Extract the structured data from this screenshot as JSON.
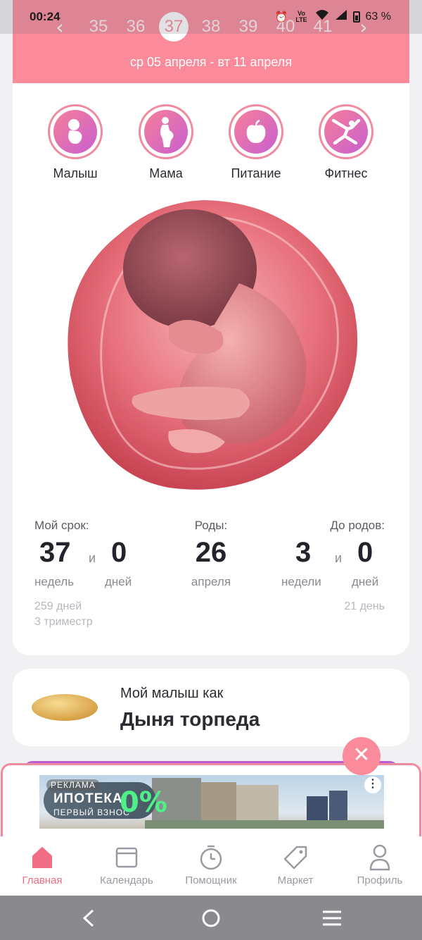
{
  "status_bar": {
    "time": "00:24",
    "network_label": "Vo LTE",
    "battery": "63 %"
  },
  "week_selector": {
    "prev_icon": "chevron-left-icon",
    "next_icon": "chevron-right-icon",
    "weeks": [
      "35",
      "36",
      "37",
      "38",
      "39",
      "40",
      "41"
    ],
    "current_week": "37",
    "date_range": "ср 05 апреля - вт 11 апреля"
  },
  "categories": [
    {
      "label": "Малыш",
      "icon": "baby-icon"
    },
    {
      "label": "Мама",
      "icon": "pregnant-mother-icon"
    },
    {
      "label": "Питание",
      "icon": "apple-icon"
    },
    {
      "label": "Фитнес",
      "icon": "fitness-icon"
    }
  ],
  "stats": {
    "term": {
      "title": "Мой срок:",
      "weeks_value": "37",
      "connector": "и",
      "days_value": "0",
      "weeks_unit": "недель",
      "days_unit": "дней",
      "total_days": "259 дней",
      "trimester": "3 триместр"
    },
    "birth": {
      "title": "Роды:",
      "day": "26",
      "month": "апреля"
    },
    "remaining": {
      "title": "До родов:",
      "weeks_value": "3",
      "connector": "и",
      "days_value": "0",
      "weeks_unit": "недели",
      "days_unit": "дней",
      "total_days": "21 день"
    }
  },
  "fruit": {
    "caption": "Мой малыш как",
    "name": "Дыня торпеда"
  },
  "ad": {
    "tag": "РЕКЛАМА",
    "headline": "ИПОТЕКА",
    "subline": "ПЕРВЫЙ ВЗНОС",
    "percent": "0%",
    "more_icon": "more-vertical-icon",
    "close_icon": "close-icon"
  },
  "bottom_nav": [
    {
      "label": "Главная",
      "icon": "home-icon",
      "active": true
    },
    {
      "label": "Календарь",
      "icon": "calendar-icon",
      "active": false
    },
    {
      "label": "Помощник",
      "icon": "timer-icon",
      "active": false
    },
    {
      "label": "Маркет",
      "icon": "tag-icon",
      "active": false
    },
    {
      "label": "Профиль",
      "icon": "profile-icon",
      "active": false
    }
  ],
  "colors": {
    "accent": "#fb8a9a",
    "active_nav": "#f06d86",
    "gradient_start": "#f77f97",
    "gradient_end": "#c85fd2"
  }
}
